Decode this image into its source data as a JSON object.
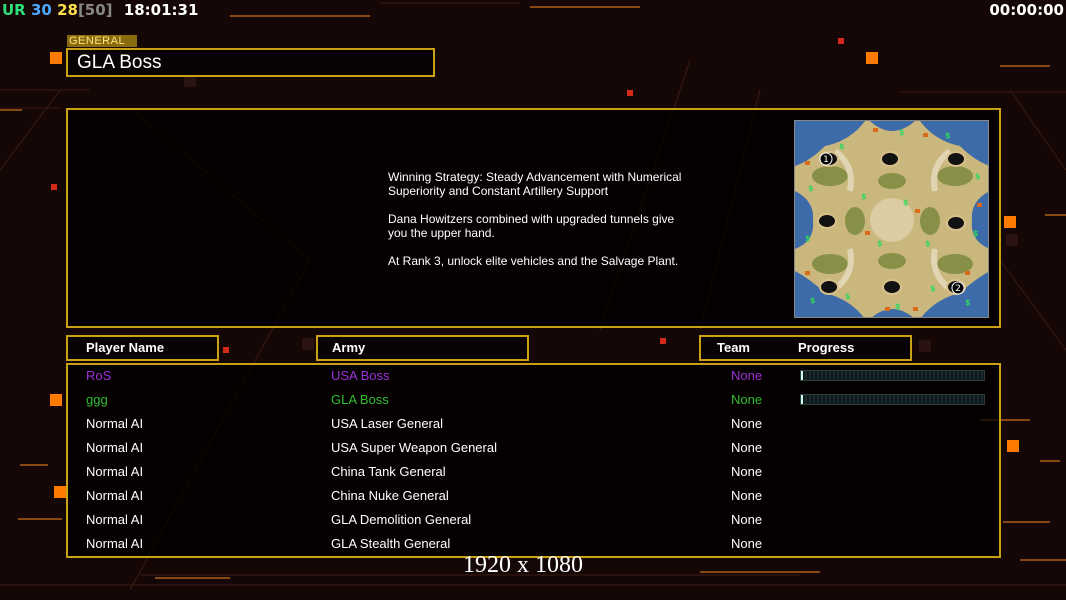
{
  "hud": {
    "ur_label": "UR",
    "stat_a": "30",
    "stat_b": "28",
    "stat_c": "[50]",
    "clock": "18:01:31",
    "timer": "00:00:00"
  },
  "general": {
    "tag": "GENERAL",
    "title": "GLA Boss"
  },
  "briefing": {
    "text": "Winning Strategy: Steady Advancement with Numerical\n Superiority and Constant Artillery Support\n\nDana Howitzers combined with upgraded tunnels give\n you the upper hand.\n\nAt Rank 3, unlock elite vehicles and the Salvage Plant."
  },
  "map": {
    "start_labels": [
      "1",
      "2"
    ]
  },
  "table": {
    "headers": {
      "player": "Player Name",
      "army": "Army",
      "team": "Team",
      "progress": "Progress"
    },
    "rows": [
      {
        "name": "RoS",
        "army": "USA Boss",
        "team": "None",
        "color": "#9b30d9",
        "progress": 0.01
      },
      {
        "name": "ggg",
        "army": "GLA Boss",
        "team": "None",
        "color": "#2fbf2f",
        "progress": 0.01
      },
      {
        "name": "Normal AI",
        "army": "USA Laser General",
        "team": "None",
        "color": "#ffffff"
      },
      {
        "name": "Normal AI",
        "army": "USA Super Weapon General",
        "team": "None",
        "color": "#ffffff"
      },
      {
        "name": "Normal AI",
        "army": "China Tank General",
        "team": "None",
        "color": "#ffffff"
      },
      {
        "name": "Normal AI",
        "army": "China Nuke General",
        "team": "None",
        "color": "#ffffff"
      },
      {
        "name": "Normal AI",
        "army": "GLA Demolition General",
        "team": "None",
        "color": "#ffffff"
      },
      {
        "name": "Normal AI",
        "army": "GLA Stealth General",
        "team": "None",
        "color": "#ffffff"
      }
    ]
  },
  "resolution": "1920 x 1080",
  "colors": {
    "frame": "#c8a214",
    "background": "#160707"
  }
}
